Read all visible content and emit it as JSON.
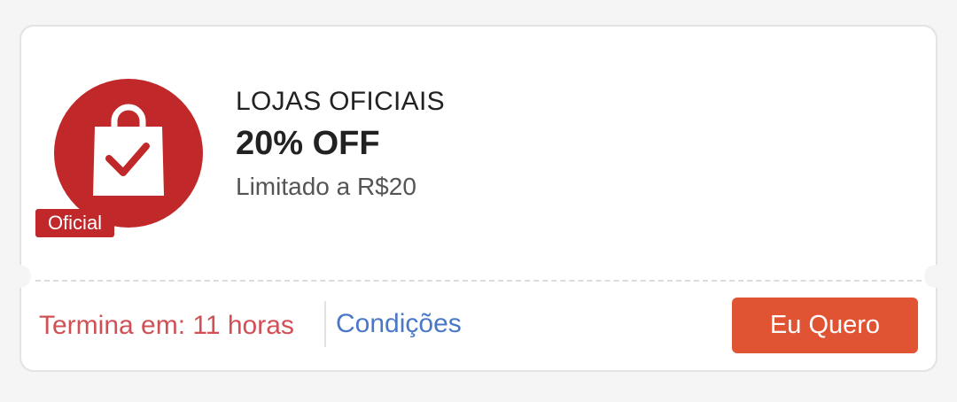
{
  "coupon": {
    "badge": {
      "icon": "shopping-bag-check-icon",
      "label": "Oficial",
      "color": "#c0282a"
    },
    "category": "LOJAS OFICIAIS",
    "discount": "20% OFF",
    "limit": "Limitado a R$20",
    "expiry": "Termina em: 11 horas",
    "conditions_link": "Condições",
    "cta_label": "Eu Quero"
  },
  "colors": {
    "background": "#f5f5f5",
    "card": "#ffffff",
    "badge": "#c0282a",
    "expiry_text": "#d05056",
    "link": "#4a78c8",
    "cta": "#e15433"
  }
}
